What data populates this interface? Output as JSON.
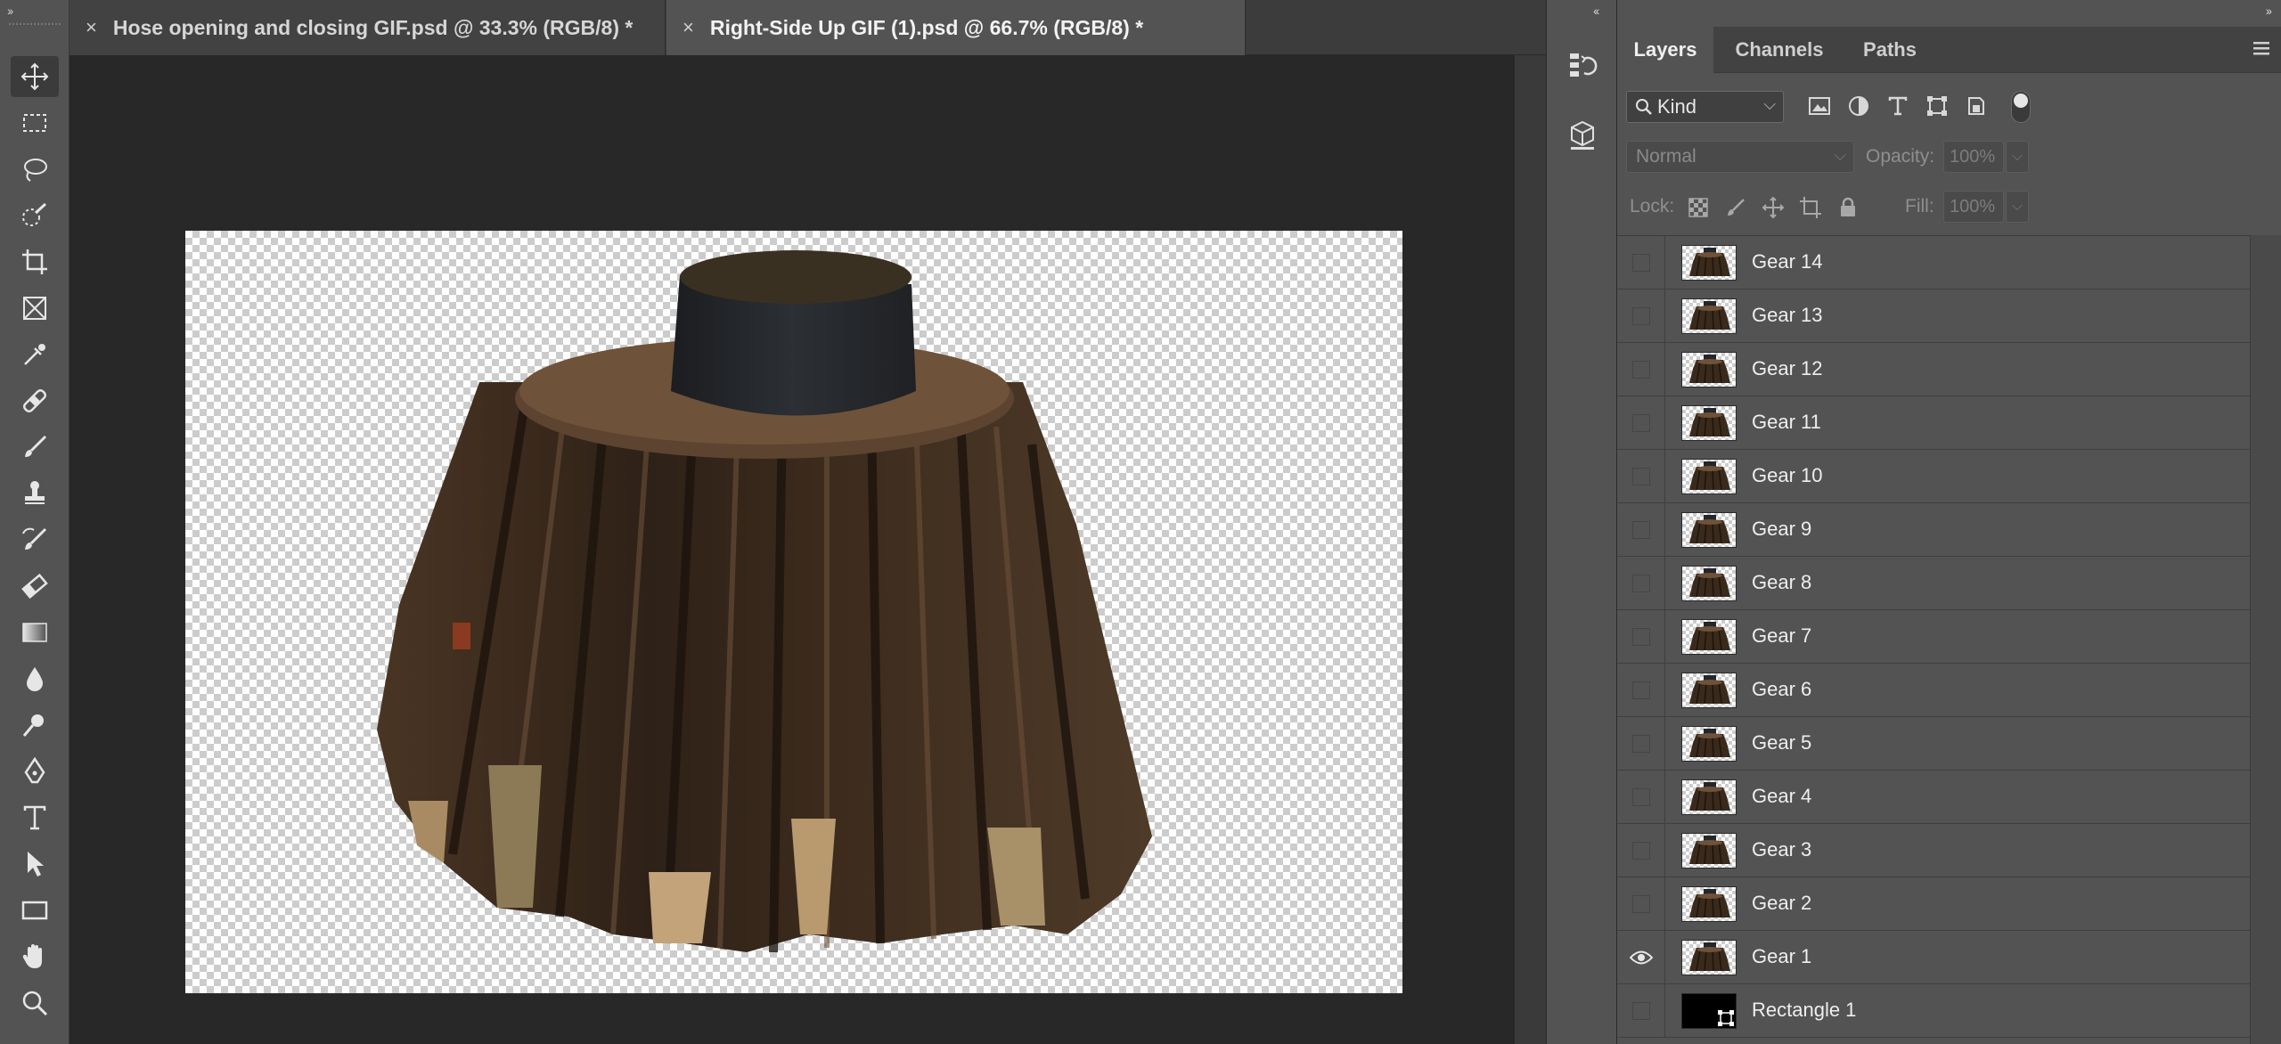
{
  "tabs": [
    {
      "label": "Hose opening and closing GIF.psd @ 33.3% (RGB/8) *",
      "active": false
    },
    {
      "label": "Right-Side Up GIF (1).psd @ 66.7% (RGB/8) *",
      "active": true
    }
  ],
  "tab_close_glyph": "×",
  "collapse_left_glyph": "››",
  "collapse_mid_glyph": "‹‹",
  "collapse_right_glyph": "››",
  "tools": [
    "move-icon",
    "rect-marquee-icon",
    "lasso-icon",
    "quick-select-icon",
    "crop-icon",
    "frame-icon",
    "eyedropper-icon",
    "healing-brush-icon",
    "brush-icon",
    "clone-stamp-icon",
    "history-brush-icon",
    "eraser-icon",
    "gradient-icon",
    "blur-icon",
    "dodge-icon",
    "pen-icon",
    "type-icon",
    "path-select-icon",
    "rectangle-icon",
    "hand-icon",
    "zoom-icon"
  ],
  "layers_panel": {
    "tabs": [
      "Layers",
      "Channels",
      "Paths"
    ],
    "filter_kind": "Kind",
    "blend_mode": "Normal",
    "opacity_label": "Opacity:",
    "opacity_value": "100%",
    "lock_label": "Lock:",
    "fill_label": "Fill:",
    "fill_value": "100%",
    "layers": [
      {
        "name": "Gear 14",
        "visible": false
      },
      {
        "name": "Gear 13",
        "visible": false
      },
      {
        "name": "Gear 12",
        "visible": false
      },
      {
        "name": "Gear 11",
        "visible": false
      },
      {
        "name": "Gear 10",
        "visible": false
      },
      {
        "name": "Gear 9",
        "visible": false
      },
      {
        "name": "Gear 8",
        "visible": false
      },
      {
        "name": "Gear 7",
        "visible": false
      },
      {
        "name": "Gear 6",
        "visible": false
      },
      {
        "name": "Gear 5",
        "visible": false
      },
      {
        "name": "Gear 4",
        "visible": false
      },
      {
        "name": "Gear 3",
        "visible": false
      },
      {
        "name": "Gear 2",
        "visible": false
      },
      {
        "name": "Gear 1",
        "visible": true
      },
      {
        "name": "Rectangle 1",
        "visible": false
      }
    ]
  },
  "colors": {
    "panel": "#535353",
    "canvas_bg": "#282828",
    "wood_dark": "#3a2a1c",
    "wood_mid": "#5a4230",
    "cap": "#23262a"
  }
}
